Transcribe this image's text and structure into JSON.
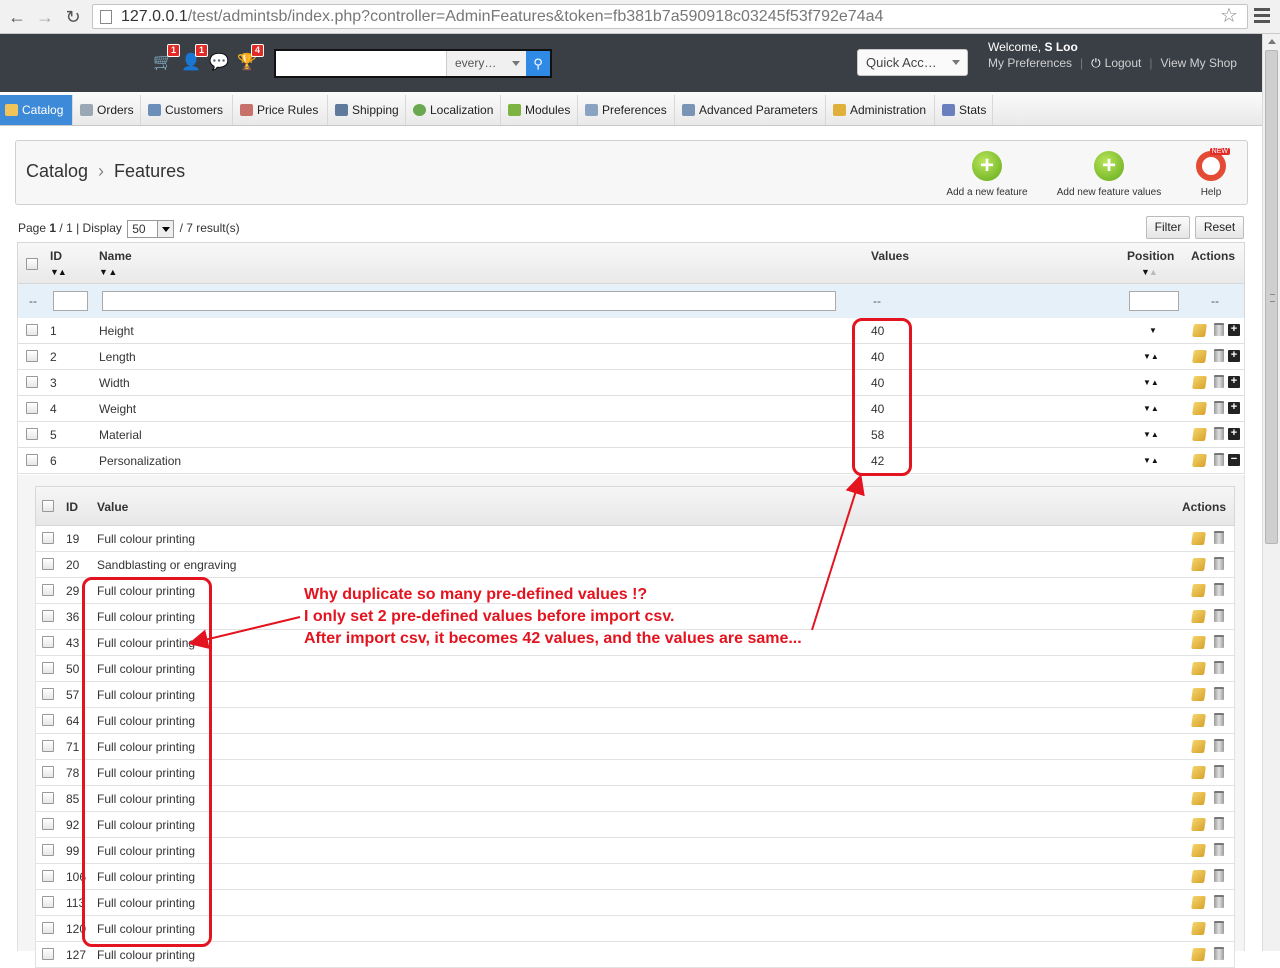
{
  "browser": {
    "url_host": "127.0.0.1",
    "url_rest": "/test/admintsb/index.php?controller=AdminFeatures&token=fb381b7a590918c03245f53f792e74a4"
  },
  "header": {
    "badges": {
      "orders": "1",
      "customers": "1",
      "messages": "",
      "trophy": "4"
    },
    "search_select": "every…",
    "quick_access": "Quick Acc…",
    "welcome_prefix": "Welcome,",
    "welcome_name": "S Loo",
    "my_preferences": "My Preferences",
    "logout": "Logout",
    "view_my_shop": "View My Shop"
  },
  "tabs": [
    {
      "label": "Catalog",
      "color": "#f0c45a"
    },
    {
      "label": "Orders",
      "color": "#9aa8b6"
    },
    {
      "label": "Customers",
      "color": "#6b8fb8"
    },
    {
      "label": "Price Rules",
      "color": "#c8706a"
    },
    {
      "label": "Shipping",
      "color": "#5f7a9a"
    },
    {
      "label": "Localization",
      "color": "#6aa84f"
    },
    {
      "label": "Modules",
      "color": "#7cb342"
    },
    {
      "label": "Preferences",
      "color": "#8aa3c2"
    },
    {
      "label": "Advanced Parameters",
      "color": "#7a94b5"
    },
    {
      "label": "Administration",
      "color": "#e0b13a"
    },
    {
      "label": "Stats",
      "color": "#6b7fbf"
    }
  ],
  "toolbar": {
    "crumb_parent": "Catalog",
    "crumb_current": "Features",
    "add_feature": "Add a new feature",
    "add_feature_values": "Add new feature values",
    "help": "Help",
    "help_new": "NEW"
  },
  "pagination": {
    "page_label": "Page",
    "page": "1",
    "of": "/ 1 | Display",
    "display": "50",
    "results": "/ 7 result(s)",
    "filter": "Filter",
    "reset": "Reset"
  },
  "features_table": {
    "headers": {
      "id": "ID",
      "name": "Name",
      "values": "Values",
      "position": "Position",
      "actions": "Actions"
    },
    "filter_dash": "--",
    "rows": [
      {
        "id": "1",
        "name": "Height",
        "values": "40",
        "pos": "▼",
        "expand": "+"
      },
      {
        "id": "2",
        "name": "Length",
        "values": "40",
        "pos": "▼▲",
        "expand": "+"
      },
      {
        "id": "3",
        "name": "Width",
        "values": "40",
        "pos": "▼▲",
        "expand": "+"
      },
      {
        "id": "4",
        "name": "Weight",
        "values": "40",
        "pos": "▼▲",
        "expand": "+"
      },
      {
        "id": "5",
        "name": "Material",
        "values": "58",
        "pos": "▼▲",
        "expand": "+"
      },
      {
        "id": "6",
        "name": "Personalization",
        "values": "42",
        "pos": "▼▲",
        "expand": "−"
      }
    ]
  },
  "values_table": {
    "headers": {
      "id": "ID",
      "value": "Value",
      "actions": "Actions"
    },
    "rows": [
      {
        "id": "19",
        "value": "Full colour printing"
      },
      {
        "id": "20",
        "value": "Sandblasting or engraving"
      },
      {
        "id": "29",
        "value": "Full colour printing"
      },
      {
        "id": "36",
        "value": "Full colour printing"
      },
      {
        "id": "43",
        "value": "Full colour printing"
      },
      {
        "id": "50",
        "value": "Full colour printing"
      },
      {
        "id": "57",
        "value": "Full colour printing"
      },
      {
        "id": "64",
        "value": "Full colour printing"
      },
      {
        "id": "71",
        "value": "Full colour printing"
      },
      {
        "id": "78",
        "value": "Full colour printing"
      },
      {
        "id": "85",
        "value": "Full colour printing"
      },
      {
        "id": "92",
        "value": "Full colour printing"
      },
      {
        "id": "99",
        "value": "Full colour printing"
      },
      {
        "id": "106",
        "value": "Full colour printing"
      },
      {
        "id": "113",
        "value": "Full colour printing"
      },
      {
        "id": "120",
        "value": "Full colour printing"
      },
      {
        "id": "127",
        "value": "Full colour printing"
      }
    ]
  },
  "annotation": {
    "line1": "Why duplicate so many pre-defined values !?",
    "line2": "I only set 2 pre-defined values before import csv.",
    "line3": "After import csv, it becomes 42 values, and the values are same...",
    "color": "#e3141f"
  }
}
